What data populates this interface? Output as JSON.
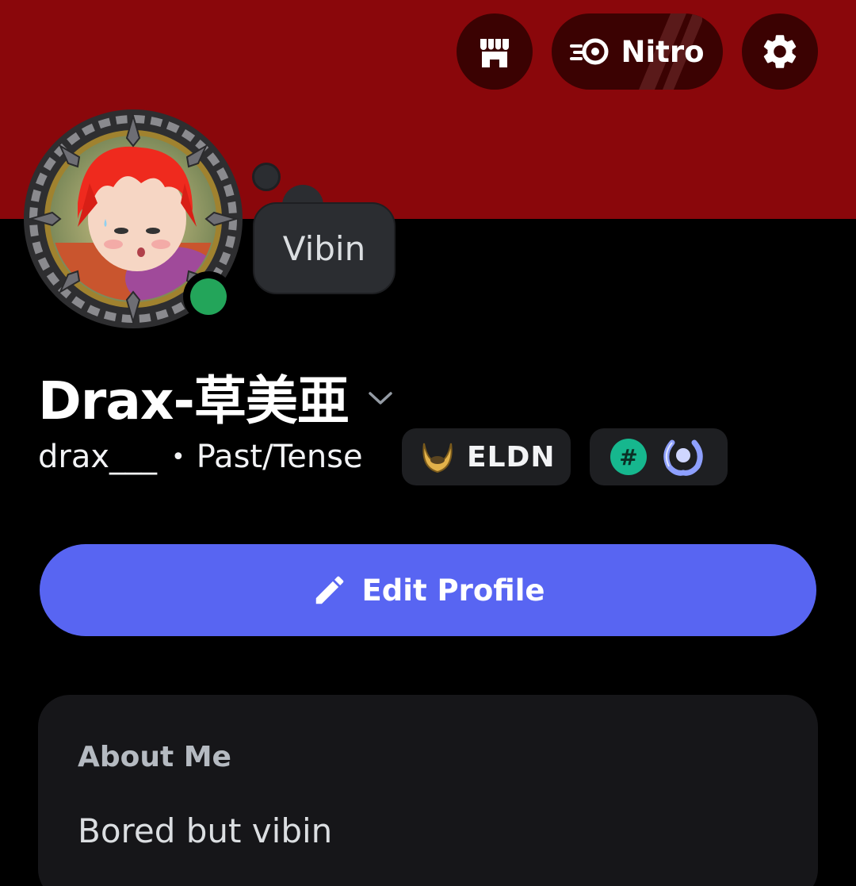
{
  "header": {
    "shop_icon": "shop-icon",
    "nitro_label": "Nitro",
    "nitro_icon": "nitro-icon",
    "settings_icon": "gear-icon"
  },
  "profile": {
    "avatar": "avatar-with-decoration",
    "status": "online",
    "status_bubble": "Vibin",
    "display_name": "Drax-草美亜",
    "username": "drax___",
    "separator": "•",
    "pronouns": "Past/Tense",
    "guild_tag": "ELDN",
    "badges": [
      "hash-badge",
      "laurel-badge"
    ]
  },
  "actions": {
    "edit_profile": "Edit Profile"
  },
  "about": {
    "title": "About Me",
    "text": "Bored but vibin"
  },
  "colors": {
    "banner": "#8a070b",
    "accent": "#5865f2",
    "online": "#23a55a"
  }
}
